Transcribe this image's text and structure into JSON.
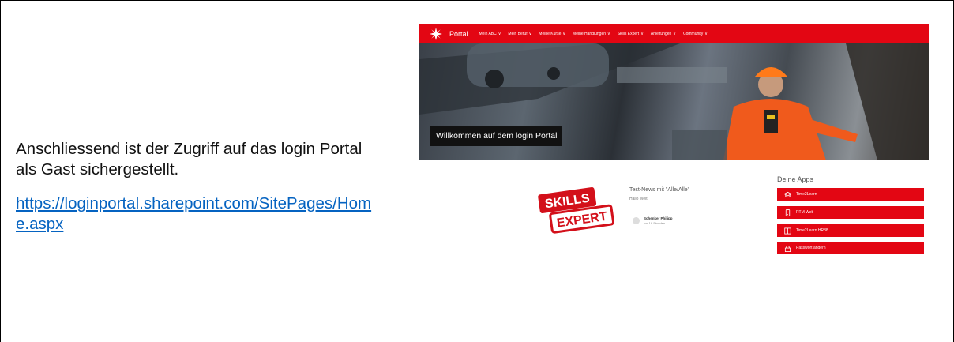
{
  "document": {
    "instruction": "Anschliessend ist der Zugriff auf das login Portal als Gast sichergestellt.",
    "link_text": "https://loginportal.sharepoint.com/SitePages/Home.aspx"
  },
  "portal": {
    "brand_label": "Portal",
    "nav": [
      {
        "label": "Mein ABC"
      },
      {
        "label": "Mein Beruf"
      },
      {
        "label": "Meine Kurse"
      },
      {
        "label": "Meine Handlungen"
      },
      {
        "label": "Skills Expert"
      },
      {
        "label": "Anleitungen"
      },
      {
        "label": "Community"
      }
    ],
    "hero_title": "Willkommen auf dem login Portal",
    "news": {
      "logo_top_text": "SKILLS",
      "logo_bottom_text": "EXPERT",
      "title": "Test-News mit \"Alle/Alle\"",
      "greeting": "Hallo Welt.",
      "author": "Schenker Philipp",
      "time": "vor 18 Stunden"
    },
    "apps_heading": "Deine Apps",
    "apps": [
      {
        "label": "Time2Learn",
        "icon": "graduation-cap-icon"
      },
      {
        "label": "RTM Web",
        "icon": "phone-icon"
      },
      {
        "label": "Time2Learn HR88",
        "icon": "book-icon"
      },
      {
        "label": "Passwort ändern",
        "icon": "lock-icon"
      }
    ],
    "colors": {
      "brand_red": "#e30613"
    }
  }
}
